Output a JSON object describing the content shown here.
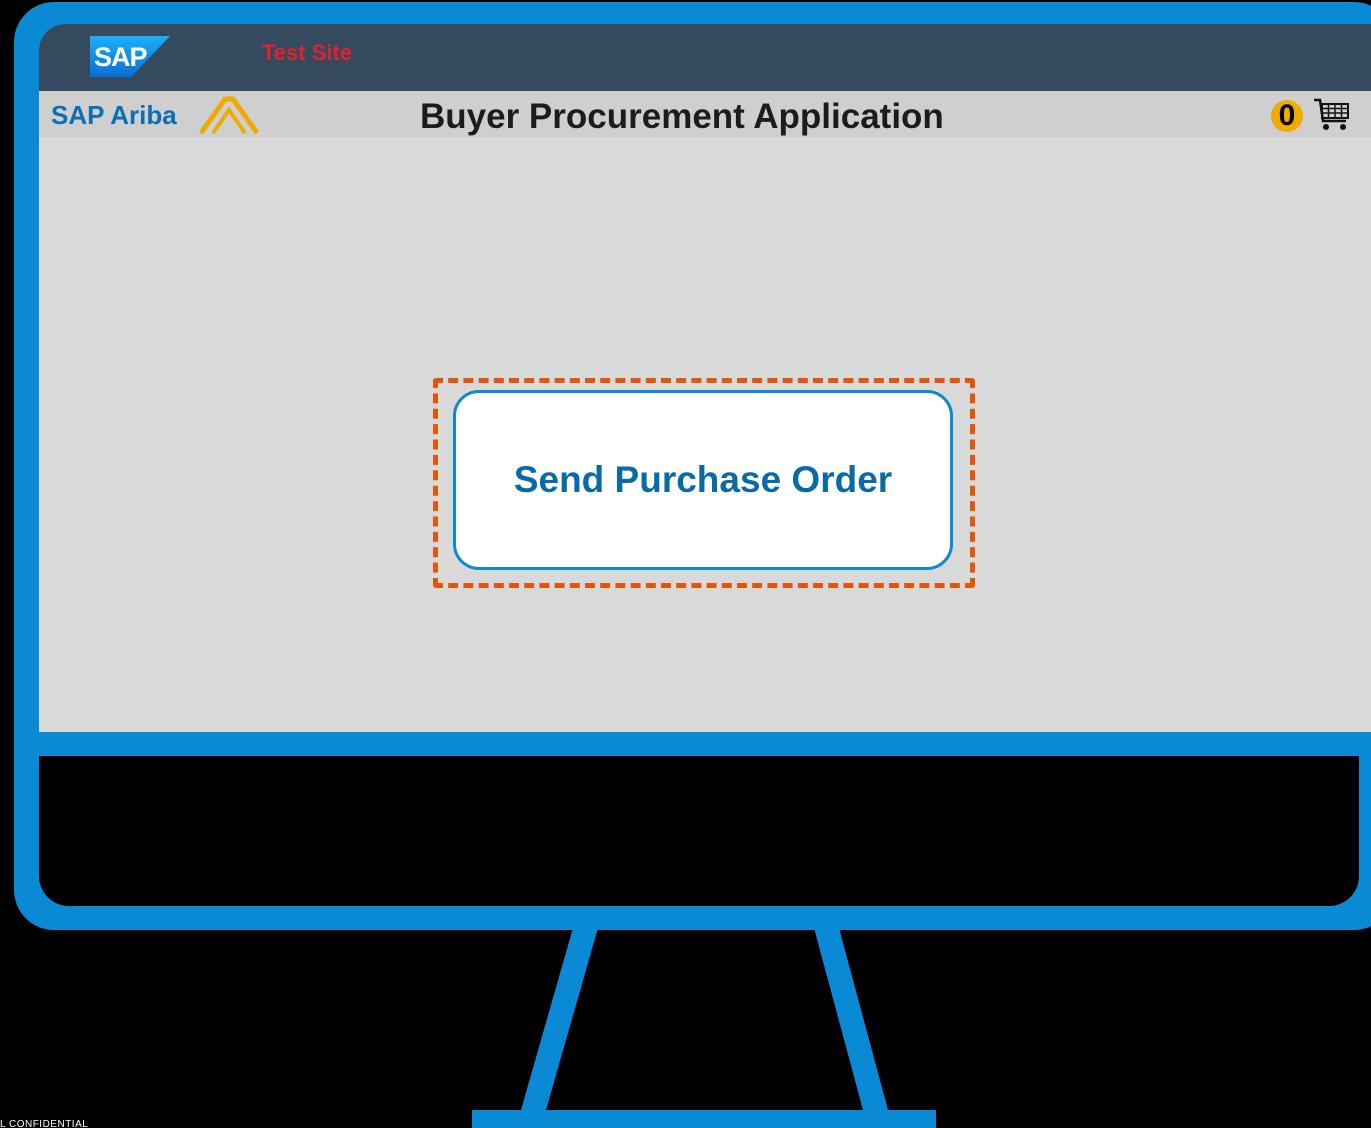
{
  "header": {
    "brand": "SAP",
    "environment_label": "Test Site",
    "environment_color": "#e5202e",
    "background_color": "#354a5f"
  },
  "titlebar": {
    "product_name": "SAP Ariba",
    "app_title": "Buyer Procurement Application",
    "cart_count": "0",
    "cart_icon": "shopping-cart-icon",
    "cart_badge_color": "#f0ab00"
  },
  "main": {
    "action_button_label": "Send Purchase Order",
    "highlight_color": "#e0560b",
    "accent_color": "#0a8ad4"
  },
  "footer": {
    "classification_text": "L CONFIDENTIAL"
  }
}
